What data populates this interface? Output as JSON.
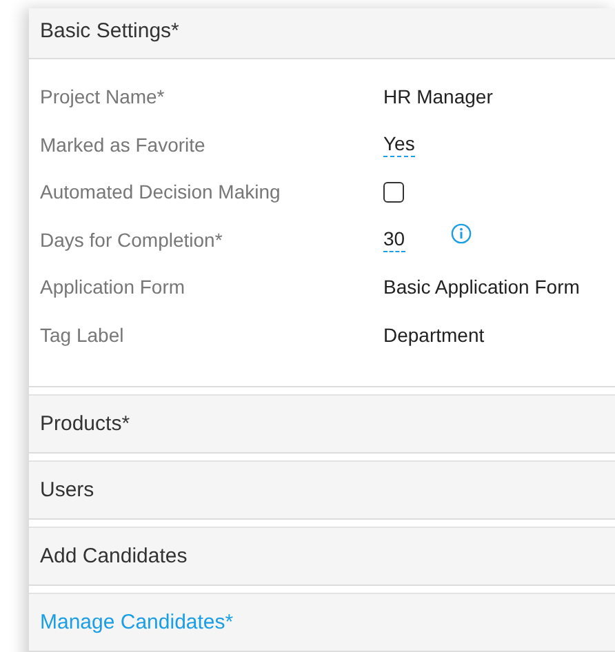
{
  "basic_settings": {
    "title": "Basic Settings*",
    "rows": [
      {
        "label": "Project Name*",
        "kind": "text",
        "value": "HR Manager"
      },
      {
        "label": "Marked as Favorite",
        "kind": "editable",
        "value": "Yes"
      },
      {
        "label": "Automated Decision Making",
        "kind": "checkbox",
        "checked": false
      },
      {
        "label": "Days for Completion*",
        "kind": "editable",
        "value": "30",
        "info": true
      },
      {
        "label": "Application Form",
        "kind": "text",
        "value": "Basic Application Form"
      },
      {
        "label": "Tag Label",
        "kind": "text",
        "value": "Department"
      }
    ]
  },
  "sections": [
    {
      "title": "Products*",
      "active": false
    },
    {
      "title": "Users",
      "active": false
    },
    {
      "title": "Add Candidates",
      "active": false
    },
    {
      "title": "Manage Candidates*",
      "active": true
    }
  ]
}
